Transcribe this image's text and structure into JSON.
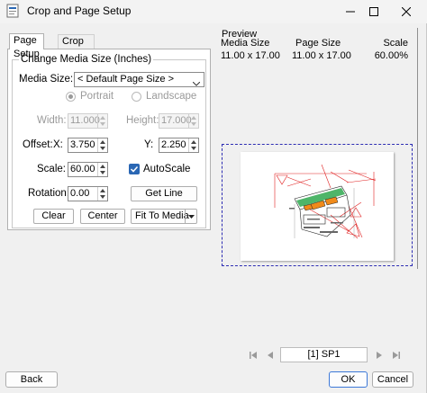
{
  "window": {
    "title": "Crop and Page Setup"
  },
  "tabs": [
    {
      "label": "Page Setup"
    },
    {
      "label": "Crop Pages"
    }
  ],
  "media": {
    "group_title": "Change Media Size (Inches)",
    "size_label": "Media Size:",
    "size_value": "< Default Page Size >",
    "orientation": {
      "portrait": "Portrait",
      "landscape": "Landscape",
      "selected": "Portrait"
    },
    "width_label": "Width:",
    "width_value": "11.000",
    "height_label": "Height:",
    "height_value": "17.000",
    "offset_label": "Offset:",
    "x_label": "X:",
    "x_value": "3.750",
    "y_label": "Y:",
    "y_value": "2.250",
    "scale_label": "Scale:",
    "scale_value": "60.00",
    "autoscale_label": "AutoScale",
    "autoscale_checked": true,
    "rotation_label": "Rotation:",
    "rotation_value": "0.00",
    "get_line_label": "Get Line",
    "clear_label": "Clear",
    "center_label": "Center",
    "fit_label": "Fit To Media"
  },
  "preview": {
    "title": "Preview",
    "media_size_label": "Media Size",
    "media_size_value": "11.00 x 17.00",
    "page_size_label": "Page Size",
    "page_size_value": "11.00 x 17.00",
    "scale_label": "Scale",
    "scale_value": "60.00%"
  },
  "navigation": {
    "page_value": "[1] SP1"
  },
  "footer": {
    "back_label": "Back",
    "ok_label": "OK",
    "cancel_label": "Cancel"
  },
  "colors": {
    "accent": "#2a67b4",
    "drawing_red": "#e02020",
    "drawing_green": "#2fa84f",
    "drawing_orange": "#f08a1a",
    "page_border": "#2c2cb3"
  }
}
